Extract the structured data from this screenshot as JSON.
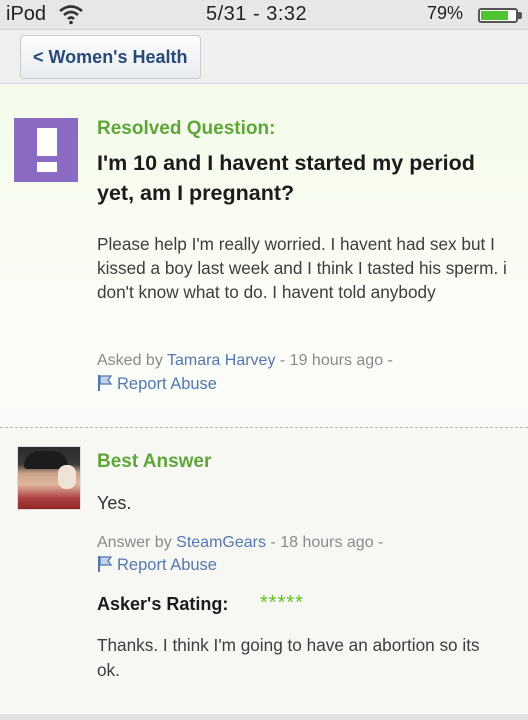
{
  "status_bar": {
    "carrier": "iPod",
    "time": "5/31 - 3:32",
    "battery_percent": "79%",
    "battery_level": 0.79
  },
  "nav": {
    "back_label": "< Women's Health"
  },
  "question": {
    "status_label": "Resolved Question:",
    "title": "I'm 10 and I havent started my period yet, am I pregnant?",
    "body": "Please help I'm really worried. I havent had sex but I kissed a boy last week and I think I tasted his sperm. i don't know what to do. I havent told anybody",
    "asked_prefix": "Asked by",
    "asker": "Tamara Harvey",
    "asked_time": "- 19 hours ago -",
    "report_label": "Report Abuse"
  },
  "best_answer": {
    "heading": "Best Answer",
    "text": "Yes.",
    "answer_prefix": "Answer by",
    "answerer": "SteamGears",
    "answer_time": "- 18 hours ago -",
    "report_label": "Report Abuse",
    "rating_label": "Asker's Rating:",
    "rating_stars": "*****",
    "rating_value": 5,
    "comment": "Thanks. I think I'm going to have an abortion so its ok."
  },
  "colors": {
    "green_heading": "#5fa63a",
    "link_blue": "#5478ac",
    "star_green": "#63c221",
    "icon_purple": "#8a6bc4"
  }
}
